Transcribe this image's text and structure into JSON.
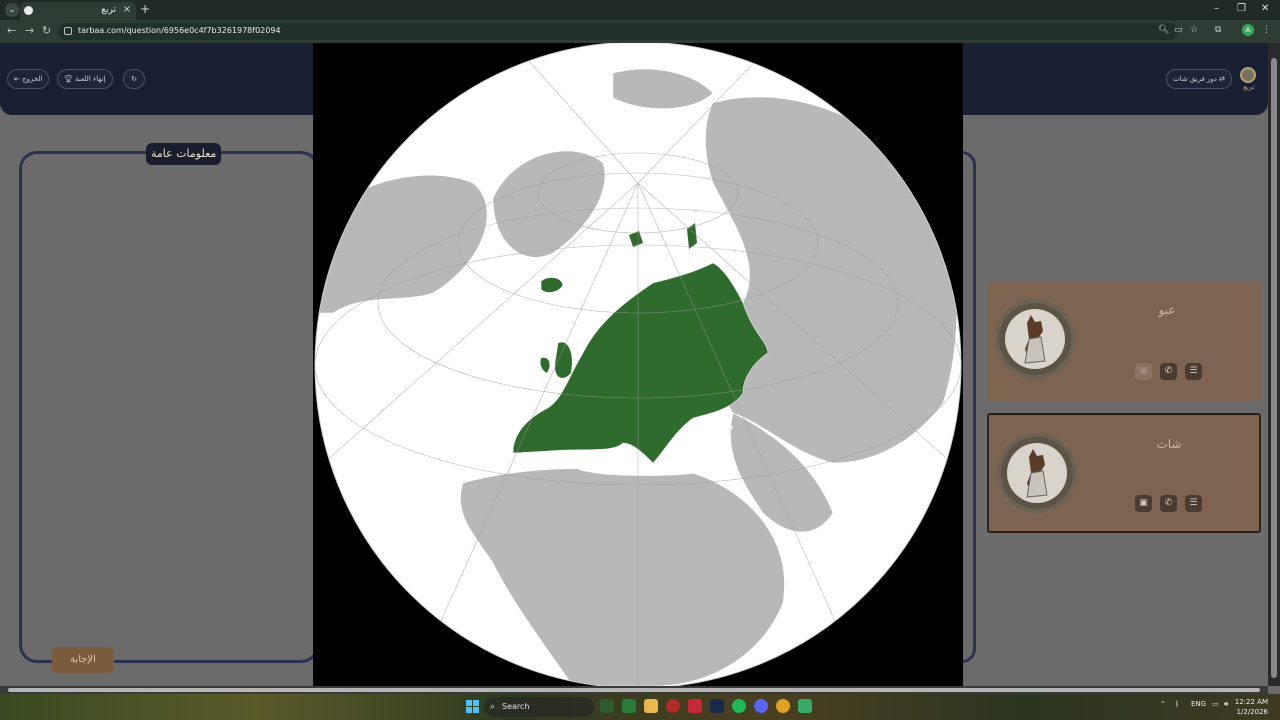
{
  "browser": {
    "tab_title": "تربع",
    "tab_close": "×",
    "new_tab": "+",
    "url": "tarbaa.com/question/6956e0c4f7b3261978f02094",
    "profile_initial": "A",
    "minimize": "–",
    "restore": "❐",
    "close": "✕",
    "back": "←",
    "forward": "→",
    "reload": "↻",
    "tab_menu": "⌄"
  },
  "header": {
    "exit_label": "الخروج",
    "end_game_label": "إنهاء اللعبة",
    "refresh_icon": "refresh-icon",
    "team_switch_label": "دور فريق شات",
    "logo_text": "تربع"
  },
  "info_panel": {
    "label": "معلومات عامة",
    "answer_button": "الإجابة"
  },
  "players": [
    {
      "name": "عبو",
      "active": false
    },
    {
      "name": "شات",
      "active": true
    }
  ],
  "taskbar": {
    "search_placeholder": "Search",
    "language": "ENG",
    "time": "12:22 AM",
    "date": "1/2/2026"
  },
  "colors": {
    "header_bg": "#1a2034",
    "card_bg": "#7d6450",
    "europe_fill": "#2e6b2c",
    "land": "#b8b8b8",
    "ocean": "#ffffff"
  }
}
